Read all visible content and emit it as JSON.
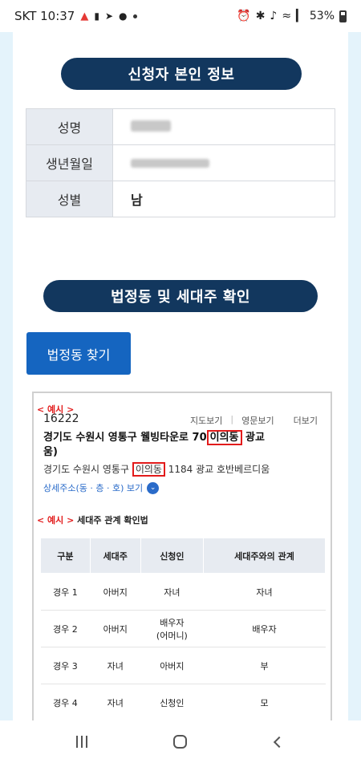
{
  "status_bar": {
    "carrier_time": "SKT 10:37",
    "battery": "53%"
  },
  "applicant": {
    "header": "신청자 본인 정보",
    "rows": [
      {
        "label": "성명",
        "value": ""
      },
      {
        "label": "생년월일",
        "value": ""
      },
      {
        "label": "성별",
        "value": "남"
      }
    ]
  },
  "legal_dong": {
    "header": "법정동 및 세대주 확인",
    "find_button": "법정동 찾기"
  },
  "example": {
    "tag": "< 예시 >",
    "zip": "16222",
    "links": [
      "지도보기",
      "영문보기",
      "더보기"
    ],
    "road_address_pre": "경기도 수원시 영통구 웰빙타운로 70",
    "road_address_dong": "이의동",
    "road_address_post": " 광교",
    "road_address_line2": "움)",
    "jibun_pre": "경기도 수원시 영통구 ",
    "jibun_dong": "이의동",
    "jibun_post": " 1184 광교 호반베르디움",
    "detail_link": "상세주소(동 · 층 · 호) 보기",
    "relation_tag": "< 예시 >",
    "relation_title": " 세대주 관계 확인법",
    "table_headers": [
      "구분",
      "세대주",
      "신청인",
      "세대주와의 관계"
    ],
    "table_rows": [
      [
        "경우 1",
        "아버지",
        "자녀",
        "자녀"
      ],
      [
        "경우 2",
        "아버지",
        "배우자\n(어머니)",
        "배우자"
      ],
      [
        "경우 3",
        "자녀",
        "아버지",
        "부"
      ],
      [
        "경우 4",
        "자녀",
        "신청인",
        "모"
      ]
    ]
  },
  "colors": {
    "navy": "#12375e",
    "button_blue": "#1565c0",
    "highlight_red": "#e21b1b"
  }
}
